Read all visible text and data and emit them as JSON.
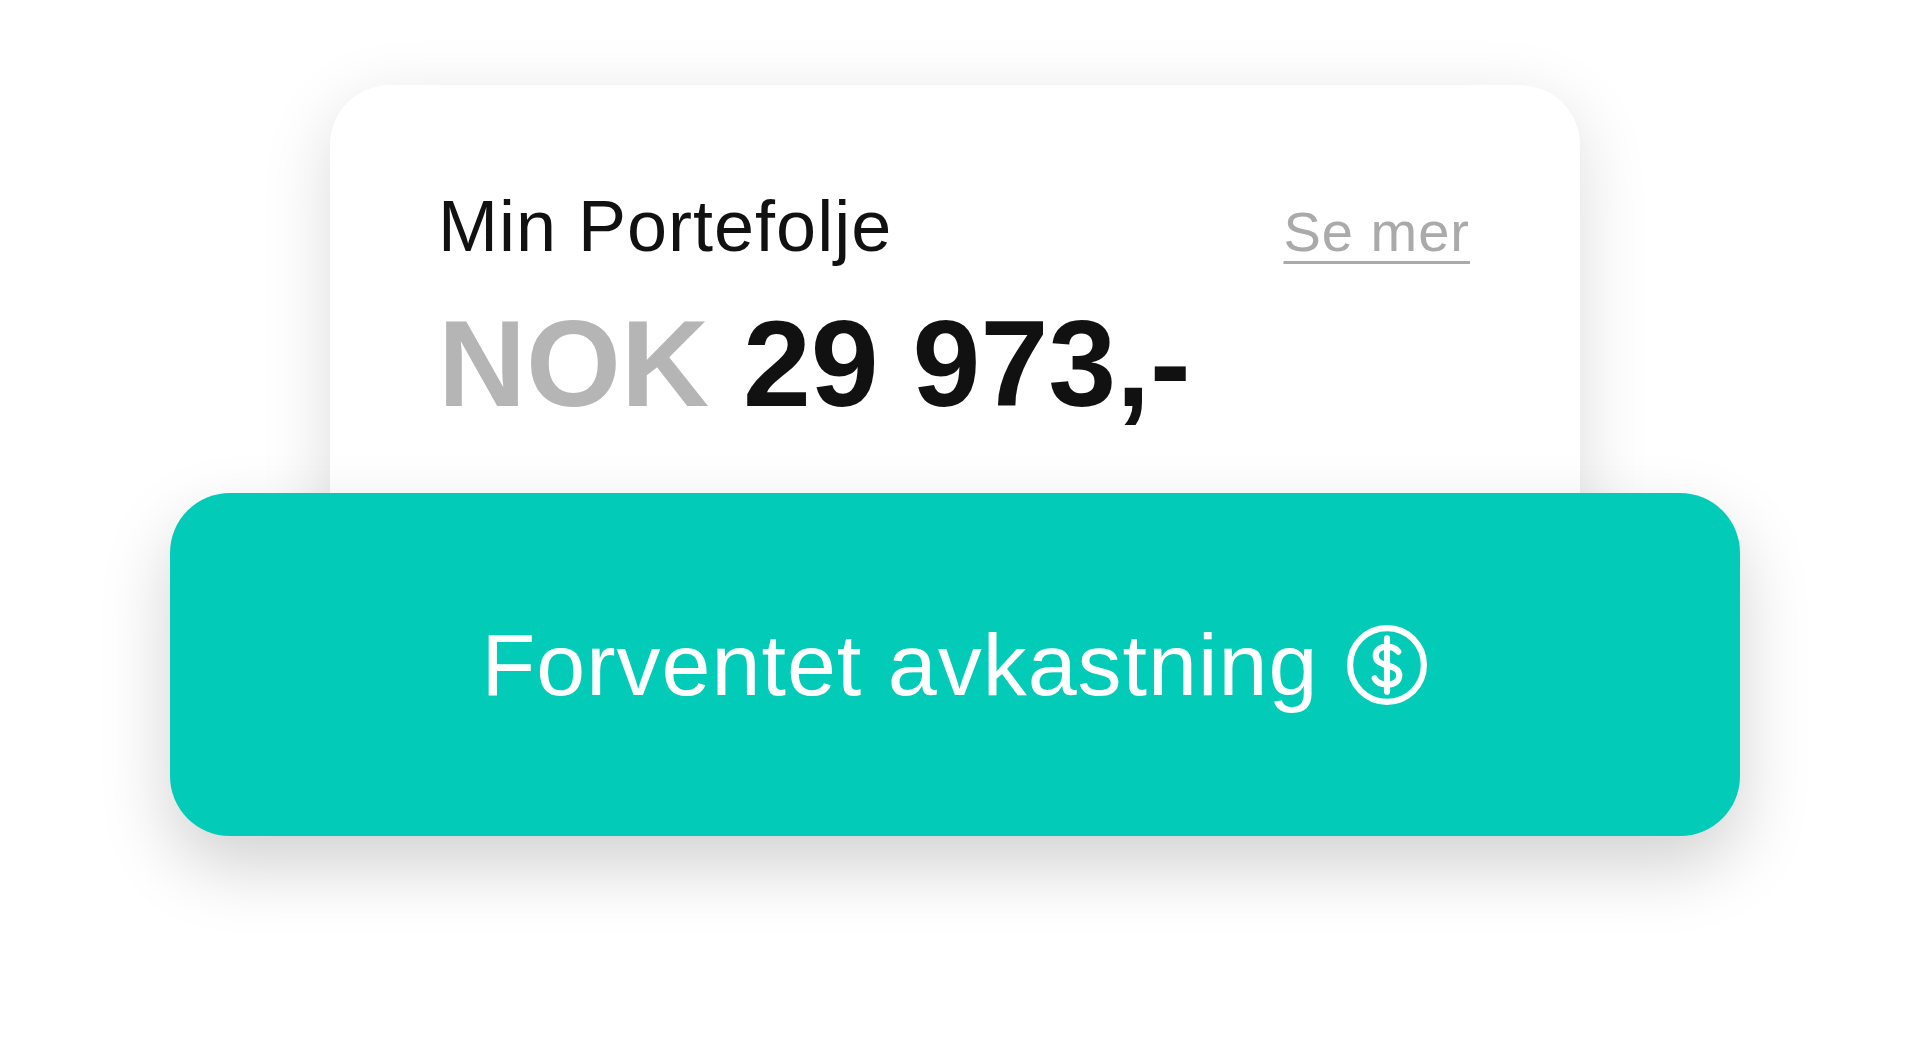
{
  "card": {
    "title": "Min Portefolje",
    "link": "Se mer",
    "currency": "NOK",
    "amount": "29 973,-"
  },
  "button": {
    "label": "Forventet avkastning"
  }
}
